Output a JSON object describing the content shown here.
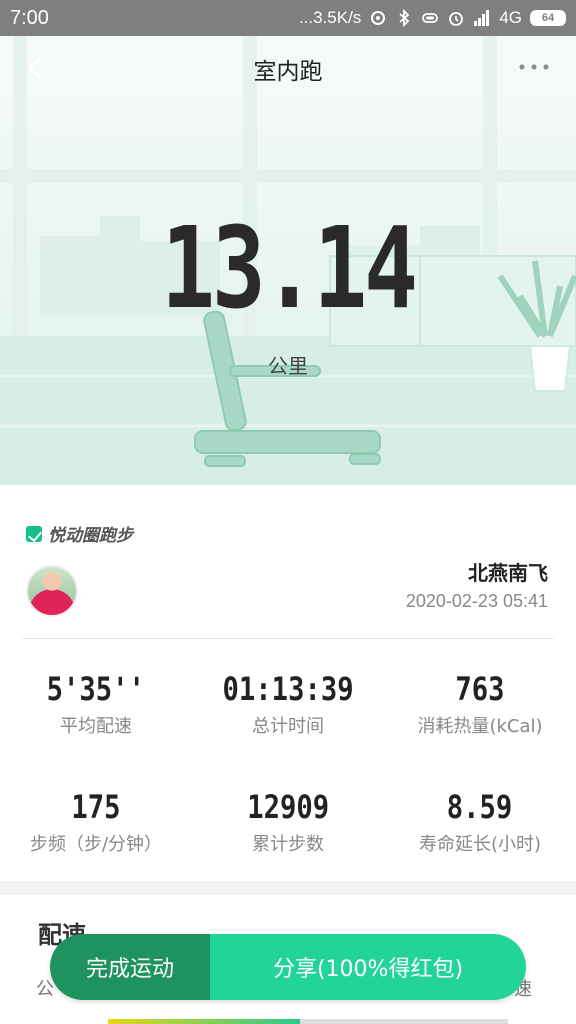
{
  "status_bar": {
    "time": "7:00",
    "network_speed": "...3.5K/s",
    "signal": "4G",
    "battery": "64",
    "icons": [
      "nfc-icon",
      "bluetooth-icon",
      "vibrate-icon",
      "alarm-icon",
      "hd-icon",
      "signal-icon"
    ]
  },
  "header": {
    "title": "室内跑",
    "back_icon": "chevron-left-icon",
    "more_icon": "more-dots-icon"
  },
  "summary": {
    "distance": "13.14",
    "distance_unit": "公里"
  },
  "brand": {
    "name": "悦动圈跑步",
    "color": "#12c08a"
  },
  "user": {
    "name": "北燕南飞",
    "datetime": "2020-02-23 05:41"
  },
  "stats": [
    {
      "value": "5'35''",
      "label": "平均配速"
    },
    {
      "value": "01:13:39",
      "label": "总计时间"
    },
    {
      "value": "763",
      "label": "消耗热量(kCal)"
    },
    {
      "value": "175",
      "label": "步频（步/分钟）"
    },
    {
      "value": "12909",
      "label": "累计步数"
    },
    {
      "value": "8.59",
      "label": "寿命延长(小时)"
    }
  ],
  "pace": {
    "title": "配速",
    "left_col": "公",
    "right_col": "速",
    "bar_fraction": 0.48
  },
  "actions": {
    "finish": "完成运动",
    "share": "分享(100%得红包)"
  },
  "colors": {
    "accent": "#22d497",
    "accent_dark": "#1e9360",
    "status_bar": "#7e807f"
  }
}
